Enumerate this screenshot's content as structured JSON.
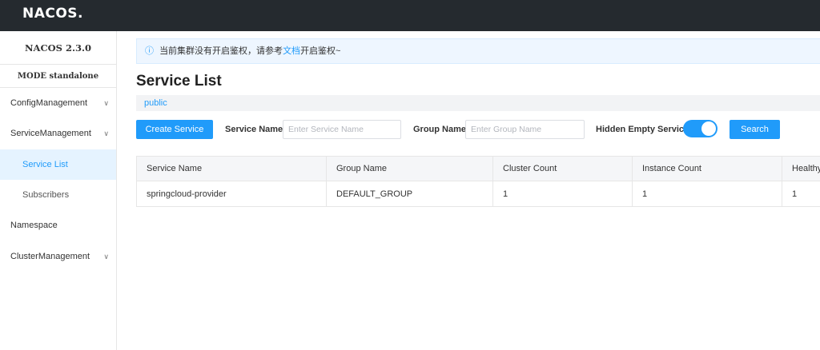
{
  "header": {
    "logo_text": "NACOS."
  },
  "sidebar": {
    "version": "NACOS 2.3.0",
    "mode": "MODE standalone",
    "items": [
      {
        "label": "ConfigManagement",
        "expandable": true
      },
      {
        "label": "ServiceManagement",
        "expandable": true
      },
      {
        "label": "Service List",
        "sub": true,
        "active": true
      },
      {
        "label": "Subscribers",
        "sub": true
      },
      {
        "label": "Namespace"
      },
      {
        "label": "ClusterManagement",
        "expandable": true
      }
    ]
  },
  "notice": {
    "text_before": "当前集群没有开启鉴权，请参考",
    "link": "文档",
    "text_after": "开启鉴权~"
  },
  "page": {
    "title": "Service List",
    "namespace": "public"
  },
  "filters": {
    "create_label": "Create Service",
    "service_name_label": "Service Name",
    "service_name_placeholder": "Enter Service Name",
    "group_name_label": "Group Name",
    "group_name_placeholder": "Enter Group Name",
    "hidden_empty_label": "Hidden Empty Service",
    "hidden_empty_on": true,
    "search_label": "Search"
  },
  "table": {
    "columns": [
      "Service Name",
      "Group Name",
      "Cluster Count",
      "Instance Count",
      "Healthy"
    ],
    "rows": [
      [
        "springcloud-provider",
        "DEFAULT_GROUP",
        "1",
        "1",
        "1"
      ]
    ]
  },
  "colors": {
    "accent": "#209bfa",
    "topbar": "#252a2f"
  }
}
